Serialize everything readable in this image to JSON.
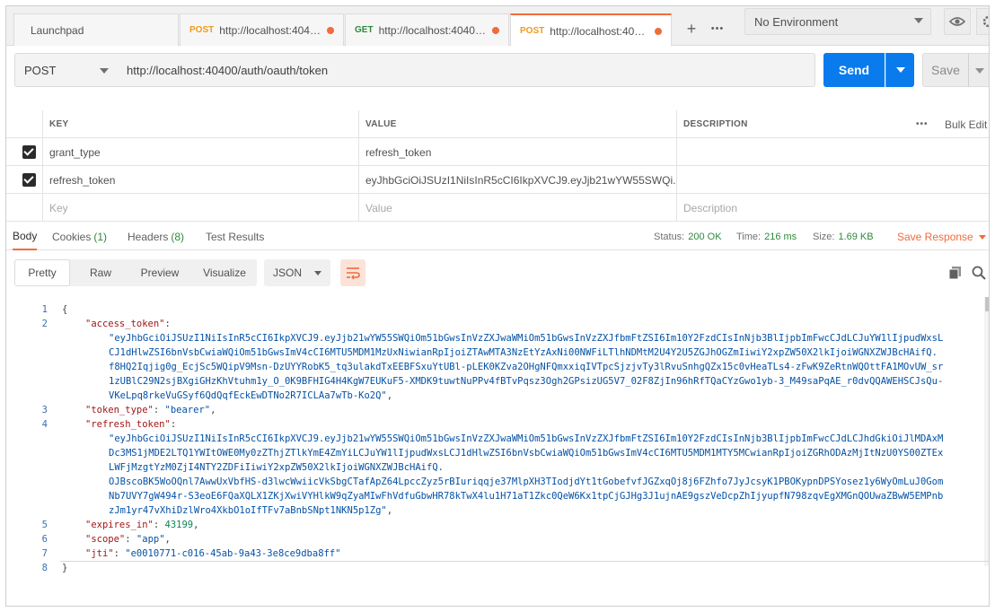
{
  "tabs": [
    {
      "method": "",
      "label": "Launchpad",
      "active": false
    },
    {
      "method": "POST",
      "label": "http://localhost:40400...",
      "dirty": true
    },
    {
      "method": "GET",
      "label": "http://localhost:40400/...",
      "dirty": true
    },
    {
      "method": "POST",
      "label": "http://localhost:40400...",
      "dirty": true,
      "active": true
    }
  ],
  "tabbar": {
    "add": "+",
    "more": "•••"
  },
  "environment": {
    "selected": "No Environment"
  },
  "request": {
    "method": "POST",
    "url": "http://localhost:40400/auth/oauth/token",
    "send_label": "Send",
    "save_label": "Save"
  },
  "params": {
    "headers": {
      "key": "KEY",
      "value": "VALUE",
      "description": "DESCRIPTION",
      "more": "•••",
      "bulk_edit": "Bulk Edit"
    },
    "rows": [
      {
        "key": "grant_type",
        "value": "refresh_token",
        "description": "",
        "checked": true
      },
      {
        "key": "refresh_token",
        "value": "eyJhbGciOiJSUzI1NiIsInR5cCI6IkpXVCJ9.eyJjb21wYW55SWQi...",
        "description": "",
        "checked": true
      }
    ],
    "placeholders": {
      "key": "Key",
      "value": "Value",
      "description": "Description"
    }
  },
  "response_tabs": [
    {
      "label": "Body",
      "count": "",
      "active": true
    },
    {
      "label": "Cookies",
      "count": "(1)"
    },
    {
      "label": "Headers",
      "count": "(8)"
    },
    {
      "label": "Test Results",
      "count": ""
    }
  ],
  "status": {
    "status_label": "Status:",
    "status_value": "200 OK",
    "time_label": "Time:",
    "time_value": "216 ms",
    "size_label": "Size:",
    "size_value": "1.69 KB",
    "save_response": "Save Response"
  },
  "format": {
    "modes": [
      "Pretty",
      "Raw",
      "Preview",
      "Visualize"
    ],
    "active_mode": "Pretty",
    "language": "JSON"
  },
  "code_lines": [
    {
      "n": "1",
      "text": "{"
    },
    {
      "n": "2",
      "key": "\"access_token\"",
      "text": ":"
    },
    {
      "n": "",
      "str": "\"eyJhbGciOiJSUzI1NiIsInR5cCI6IkpXVCJ9.eyJjb21wYW55SWQiOm51bGwsInVzZXJwaWMiOm51bGwsInVzZXJfbmFtZSI6Im10Y2FzdCIsInNjb3BlIjpbImFwcCJdLCJuYW1lIjpudWxsL"
    },
    {
      "n": "",
      "str": "CJ1dHlwZSI6bnVsbCwiaWQiOm51bGwsImV4cCI6MTU5MDM1MzUxNiwianRpIjoiZTAwMTA3NzEtYzAxNi00NWFiLTlhNDMtM2U4Y2U5ZGJhOGZmIiwiY2xpZW50X2lkIjoiWGNXZWJBcHAifQ."
    },
    {
      "n": "",
      "str": "f8HQ2Iqjig0g_EcjSc5WQipV9Msn-DzUYYRobK5_tq3ulakdTxEEBFSxuYtUBl-pLEK0KZva2OHgNFQmxxiqIVTpcSjzjvTy3lRvuSnhgQZx15c0vHeaTLs4-zFwK9ZeRtnWQOttFA1MOvUW_sr"
    },
    {
      "n": "",
      "str": "1zUBlC29N2sjBXgiGHzKhVtuhm1y_O_0K9BFHIG4H4KgW7EUKuF5-XMDK9tuwtNuPPv4fBTvPqsz3Ogh2GPsizUG5V7_02F8ZjIn96hRfTQaCYzGwo1yb-3_M49saPqAE_r0dvQQAWEHSCJsQu-"
    },
    {
      "n": "",
      "str": "VKeLpq8rkeVuGSyf6QdQqfEckEwDTNo2R7ICLAa7wTb-Ko2Q\"",
      "text": ","
    },
    {
      "n": "3",
      "key": "\"token_type\"",
      "text": ": ",
      "str2": "\"bearer\"",
      "tail": ","
    },
    {
      "n": "4",
      "key": "\"refresh_token\"",
      "text": ":"
    },
    {
      "n": "",
      "str": "\"eyJhbGciOiJSUzI1NiIsInR5cCI6IkpXVCJ9.eyJjb21wYW55SWQiOm51bGwsInVzZXJwaWMiOm51bGwsInVzZXJfbmFtZSI6Im10Y2FzdCIsInNjb3BlIjpbImFwcCJdLCJhdGkiOiJlMDAxM"
    },
    {
      "n": "",
      "str": "Dc3MS1jMDE2LTQ1YWItOWE0My0zZThjZTlkYmE4ZmYiLCJuYW1lIjpudWxsLCJ1dHlwZSI6bnVsbCwiaWQiOm51bGwsImV4cCI6MTU5MDM1MTY5MCwianRpIjoiZGRhODAzMjItNzU0YS00ZTEx"
    },
    {
      "n": "",
      "str": "LWFjMzgtYzM0ZjI4NTY2ZDFiIiwiY2xpZW50X2lkIjoiWGNXZWJBcHAifQ."
    },
    {
      "n": "",
      "str": "OJBscoBK5WoOQnl7AwwUxVbfHS-d3lwcWwiicVkSbgCTafApZ64LpccZyz5rBIuriqqje37MlpXH3TIodjdYt1tGobefvfJGZxqOj8j6FZhfo7JyJcsyK1PBOKypnDPSYosez1y6WyOmLuJ0Gom"
    },
    {
      "n": "",
      "str": "Nb7UVY7gW494r-S3eoE6FQaXQLX1ZKjXwiVYHlkW9qZyaMIwFhVdfuGbwHR78kTwX4lu1H71aT1Zkc0QeW6Kx1tpCjGJHg3J1ujnAE9gszVeDcpZhIjyupfN798zqvEgXMGnQOUwaZBwW5EMPnb"
    },
    {
      "n": "",
      "str": "zJm1yr47vXhiDzlWro4XkbO1oIfTFv7aBnbSNpt1NKN5p1Zg\"",
      "text": ","
    },
    {
      "n": "5",
      "key": "\"expires_in\"",
      "text": ": ",
      "num": "43199",
      "tail": ","
    },
    {
      "n": "6",
      "key": "\"scope\"",
      "text": ": ",
      "str2": "\"app\"",
      "tail": ","
    },
    {
      "n": "7",
      "key": "\"jti\"",
      "text": ": ",
      "str2": "\"e0010771-c016-45ab-9a43-3e8ce9dba8ff\"",
      "tail": ""
    },
    {
      "n": "8",
      "text": "}"
    }
  ],
  "colors": {
    "accent": "#f26b3a",
    "send": "#097bed",
    "status_ok": "#2e8a3c"
  }
}
